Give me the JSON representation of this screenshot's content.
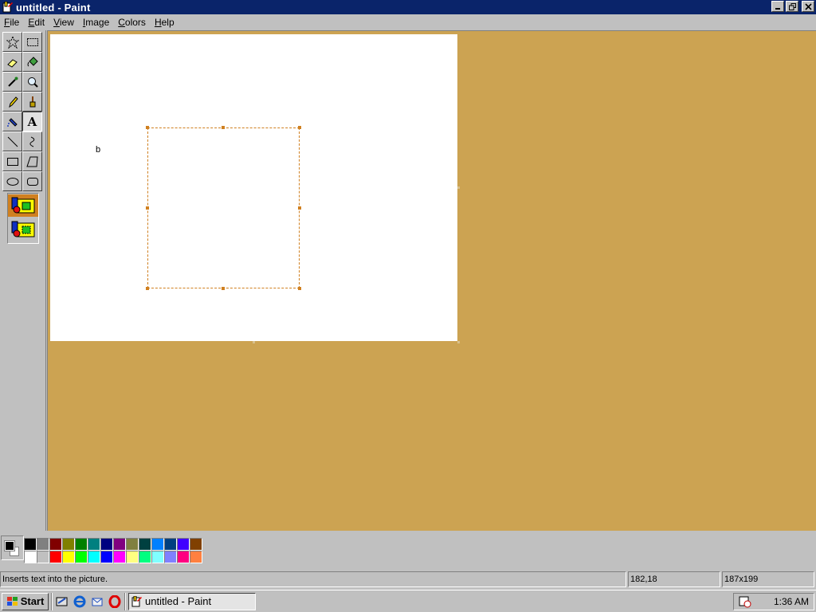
{
  "window": {
    "title": "untitled - Paint",
    "controls": {
      "minimize": "_",
      "restore": "❐",
      "close": "✕"
    }
  },
  "menu": [
    "File",
    "Edit",
    "View",
    "Image",
    "Colors",
    "Help"
  ],
  "tools": [
    {
      "name": "free-form-select",
      "icon": "star-select-icon"
    },
    {
      "name": "select",
      "icon": "rect-select-icon"
    },
    {
      "name": "eraser",
      "icon": "eraser-icon"
    },
    {
      "name": "fill",
      "icon": "fill-bucket-icon"
    },
    {
      "name": "pick-color",
      "icon": "eyedropper-icon"
    },
    {
      "name": "magnifier",
      "icon": "magnifier-icon"
    },
    {
      "name": "pencil",
      "icon": "pencil-icon"
    },
    {
      "name": "brush",
      "icon": "brush-icon"
    },
    {
      "name": "airbrush",
      "icon": "airbrush-icon"
    },
    {
      "name": "text",
      "icon": "text-icon",
      "label": "A",
      "active": true
    },
    {
      "name": "line",
      "icon": "line-icon"
    },
    {
      "name": "curve",
      "icon": "curve-icon"
    },
    {
      "name": "rectangle",
      "icon": "rectangle-icon"
    },
    {
      "name": "polygon",
      "icon": "polygon-icon"
    },
    {
      "name": "ellipse",
      "icon": "ellipse-icon"
    },
    {
      "name": "rounded-rectangle",
      "icon": "rounded-rect-icon"
    }
  ],
  "canvas": {
    "typed_text": "b"
  },
  "palette": {
    "foreground": "#000000",
    "background": "#ffffff",
    "row1": [
      "#000000",
      "#808080",
      "#800000",
      "#808000",
      "#008000",
      "#008080",
      "#000080",
      "#800080",
      "#808040",
      "#004040",
      "#0080ff",
      "#004080",
      "#4000ff",
      "#804000"
    ],
    "row2": [
      "#ffffff",
      "#c0c0c0",
      "#ff0000",
      "#ffff00",
      "#00ff00",
      "#00ffff",
      "#0000ff",
      "#ff00ff",
      "#ffff80",
      "#00ff80",
      "#80ffff",
      "#8080ff",
      "#ff0080",
      "#ff8040"
    ]
  },
  "status": {
    "message": "Inserts text into the picture.",
    "coords": "182,18",
    "size": "187x199"
  },
  "taskbar": {
    "start_label": "Start",
    "quick_launch": [
      "show-desktop-icon",
      "ie-icon",
      "outlook-icon",
      "opera-icon"
    ],
    "task_label": "untitled - Paint",
    "clock": "1:36 AM"
  }
}
